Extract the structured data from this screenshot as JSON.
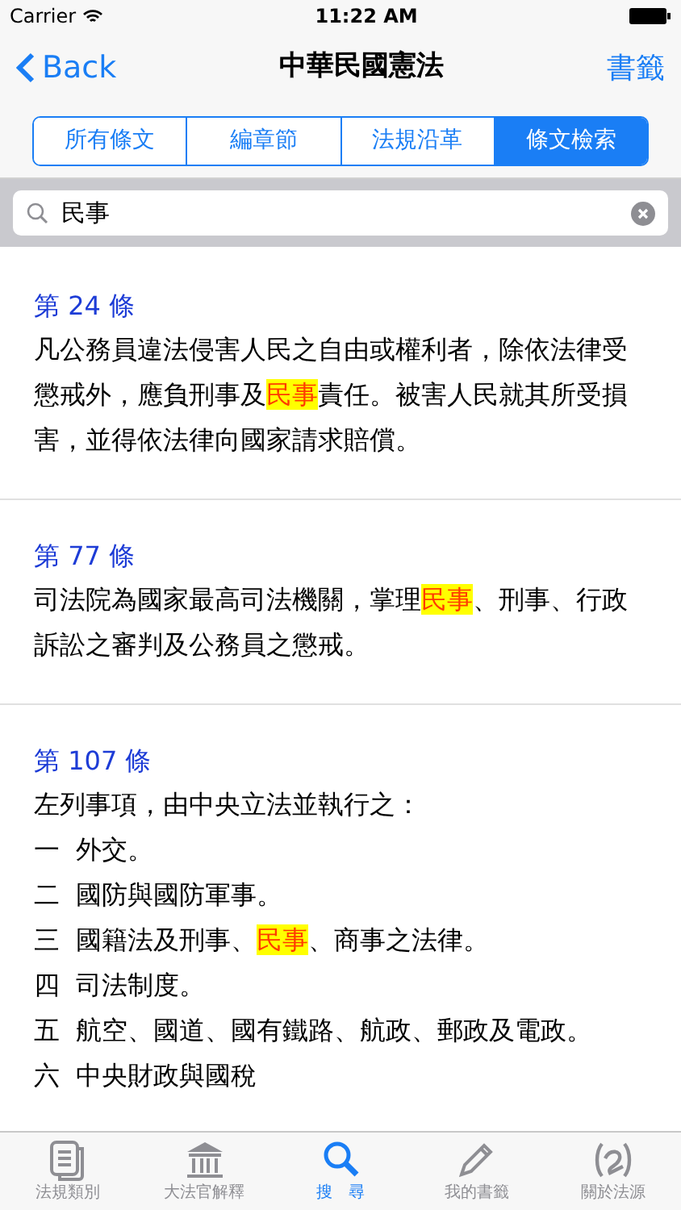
{
  "status_bar": {
    "carrier": "Carrier",
    "time": "11:22 AM"
  },
  "nav": {
    "back": "Back",
    "title": "中華民國憲法",
    "right": "書籤"
  },
  "segments": [
    {
      "label": "所有條文",
      "selected": false
    },
    {
      "label": "編章節",
      "selected": false
    },
    {
      "label": "法規沿革",
      "selected": false
    },
    {
      "label": "條文檢索",
      "selected": true
    }
  ],
  "search": {
    "value": "民事"
  },
  "articles": [
    {
      "heading": "第 24 條",
      "paragraphs": [
        {
          "segments": [
            {
              "text": "凡公務員違法侵害人民之自由或權利者，除依法律受懲戒外，應負刑事及",
              "highlight": false
            },
            {
              "text": "民事",
              "highlight": true
            },
            {
              "text": "責任。被害人民就其所受損害，並得依法律向國家請求賠償。",
              "highlight": false
            }
          ]
        }
      ]
    },
    {
      "heading": "第 77 條",
      "paragraphs": [
        {
          "segments": [
            {
              "text": "司法院為國家最高司法機關，掌理",
              "highlight": false
            },
            {
              "text": "民事",
              "highlight": true
            },
            {
              "text": "、刑事、行政訴訟之審判及公務員之懲戒。",
              "highlight": false
            }
          ]
        }
      ]
    },
    {
      "heading": "第 107 條",
      "paragraphs": [
        {
          "segments": [
            {
              "text": "左列事項，由中央立法並執行之：",
              "highlight": false
            }
          ]
        },
        {
          "number": "一",
          "segments": [
            {
              "text": "外交。",
              "highlight": false
            }
          ]
        },
        {
          "number": "二",
          "segments": [
            {
              "text": "國防與國防軍事。",
              "highlight": false
            }
          ]
        },
        {
          "number": "三",
          "segments": [
            {
              "text": "國籍法及刑事、",
              "highlight": false
            },
            {
              "text": "民事",
              "highlight": true
            },
            {
              "text": "、商事之法律。",
              "highlight": false
            }
          ]
        },
        {
          "number": "四",
          "segments": [
            {
              "text": "司法制度。",
              "highlight": false
            }
          ]
        },
        {
          "number": "五",
          "segments": [
            {
              "text": "航空、國道、國有鐵路、航政、郵政及電政。",
              "highlight": false
            }
          ]
        },
        {
          "number": "六",
          "segments": [
            {
              "text": "中央財政與國稅",
              "highlight": false
            }
          ]
        }
      ]
    }
  ],
  "tab_bar": [
    {
      "label": "法規類別",
      "selected": false
    },
    {
      "label": "大法官解釋",
      "selected": false
    },
    {
      "label": "搜　尋",
      "selected": true
    },
    {
      "label": "我的書籤",
      "selected": false
    },
    {
      "label": "關於法源",
      "selected": false
    }
  ]
}
